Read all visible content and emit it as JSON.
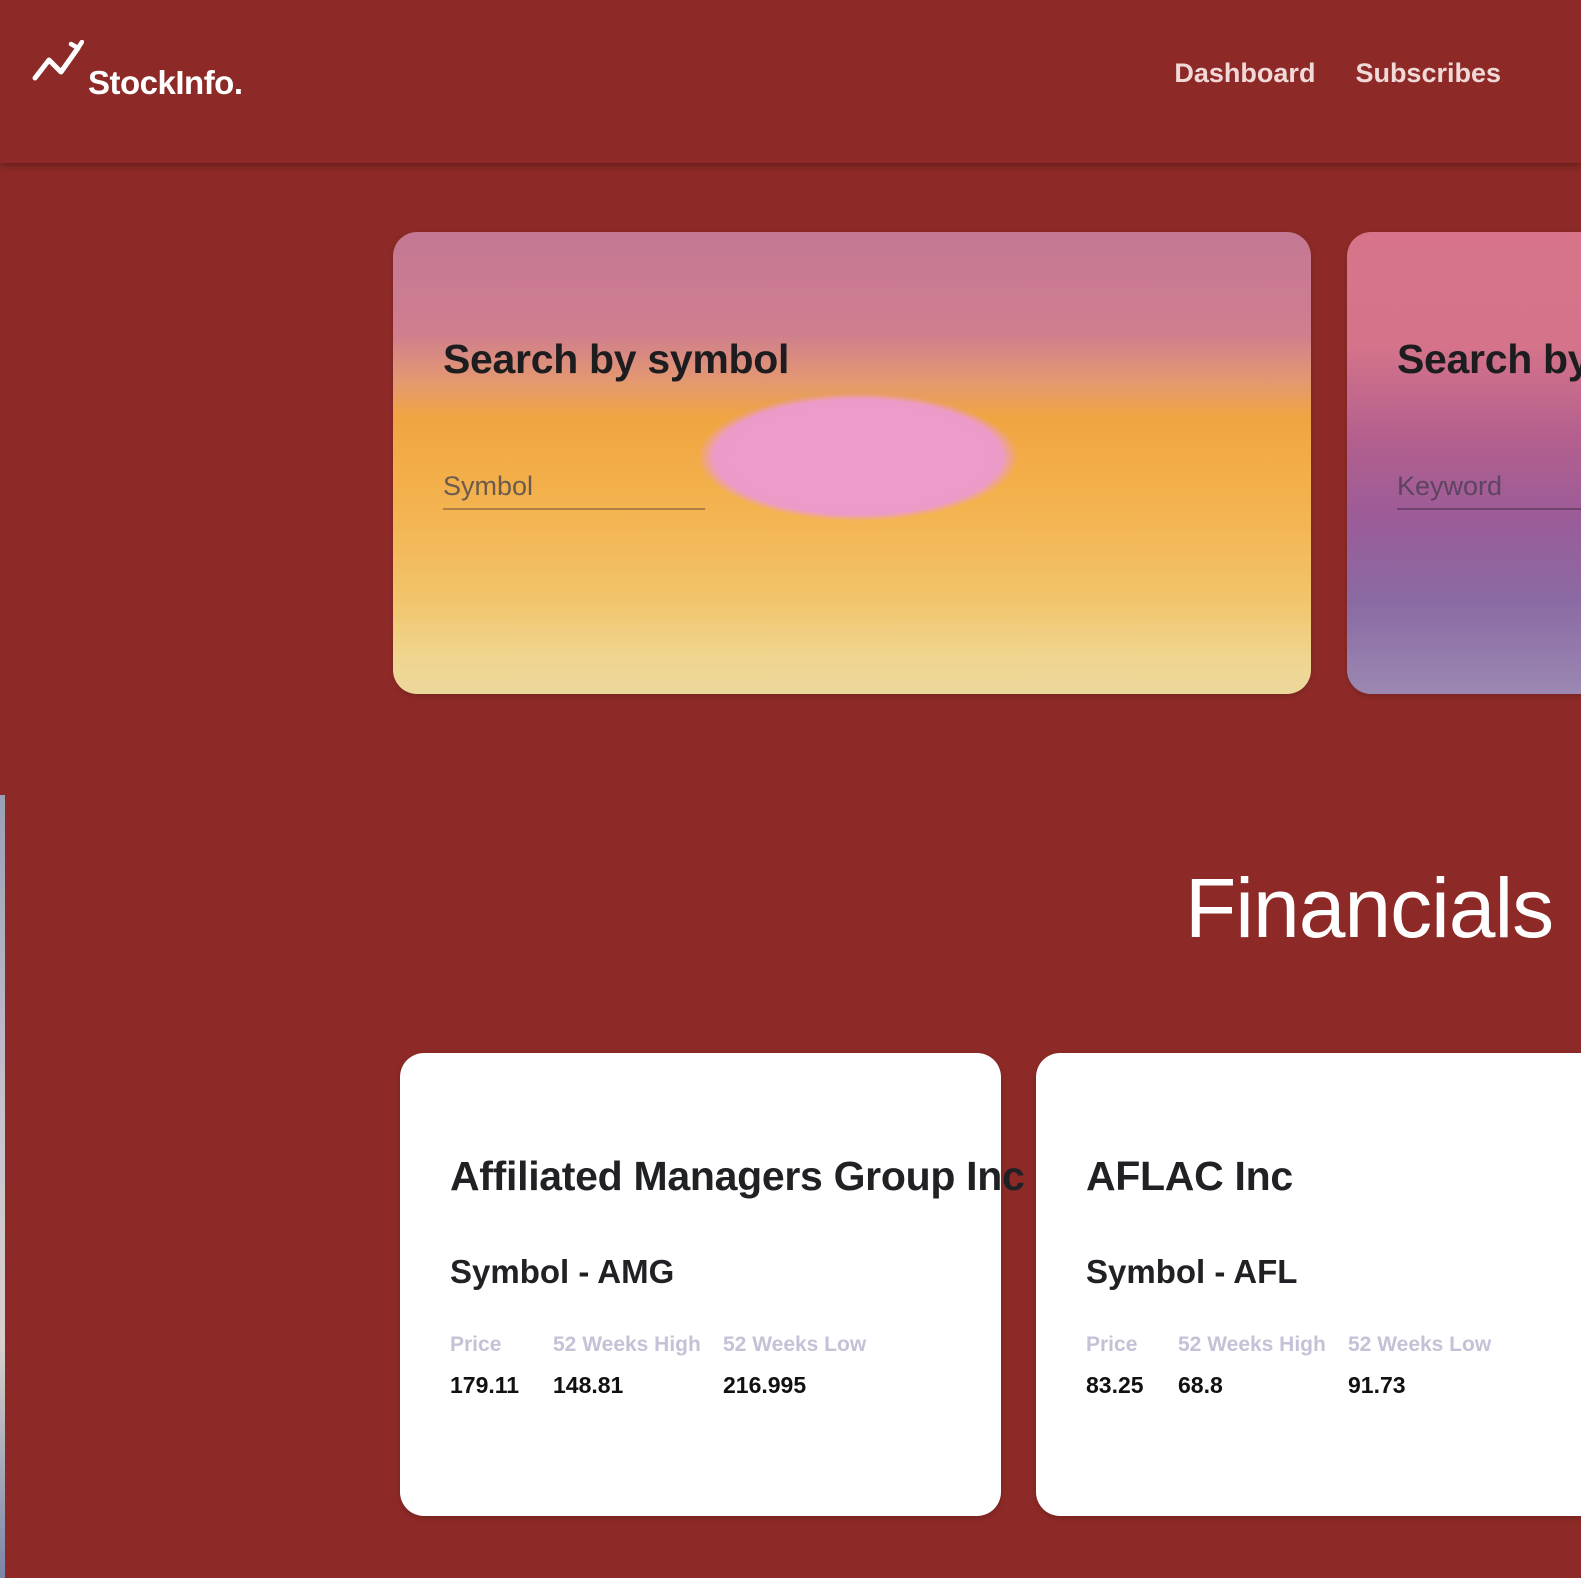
{
  "header": {
    "brand": "StockInfo.",
    "logo_icon": "chart-trend-icon",
    "nav": [
      {
        "label": "Dashboard"
      },
      {
        "label": "Subscribes"
      }
    ]
  },
  "search": {
    "symbol_card": {
      "title": "Search by symbol",
      "placeholder": "Symbol"
    },
    "keyword_card": {
      "title": "Search by",
      "placeholder": "Keyword"
    }
  },
  "financials": {
    "title": "Financials",
    "stocks": [
      {
        "name": "Affiliated Managers Group Inc",
        "symbol_line": "Symbol - AMG",
        "labels": {
          "price": "Price",
          "high": "52 Weeks High",
          "low": "52 Weeks Low"
        },
        "price": "179.11",
        "high": "148.81",
        "low": "216.995"
      },
      {
        "name": "AFLAC Inc",
        "symbol_line": "Symbol - AFL",
        "labels": {
          "price": "Price",
          "high": "52 Weeks High",
          "low": "52 Weeks Low"
        },
        "price": "83.25",
        "high": "68.8",
        "low": "91.73"
      }
    ]
  },
  "colors": {
    "background": "#8d2a27",
    "card": "#ffffff",
    "label_muted": "#c4c2d6"
  }
}
